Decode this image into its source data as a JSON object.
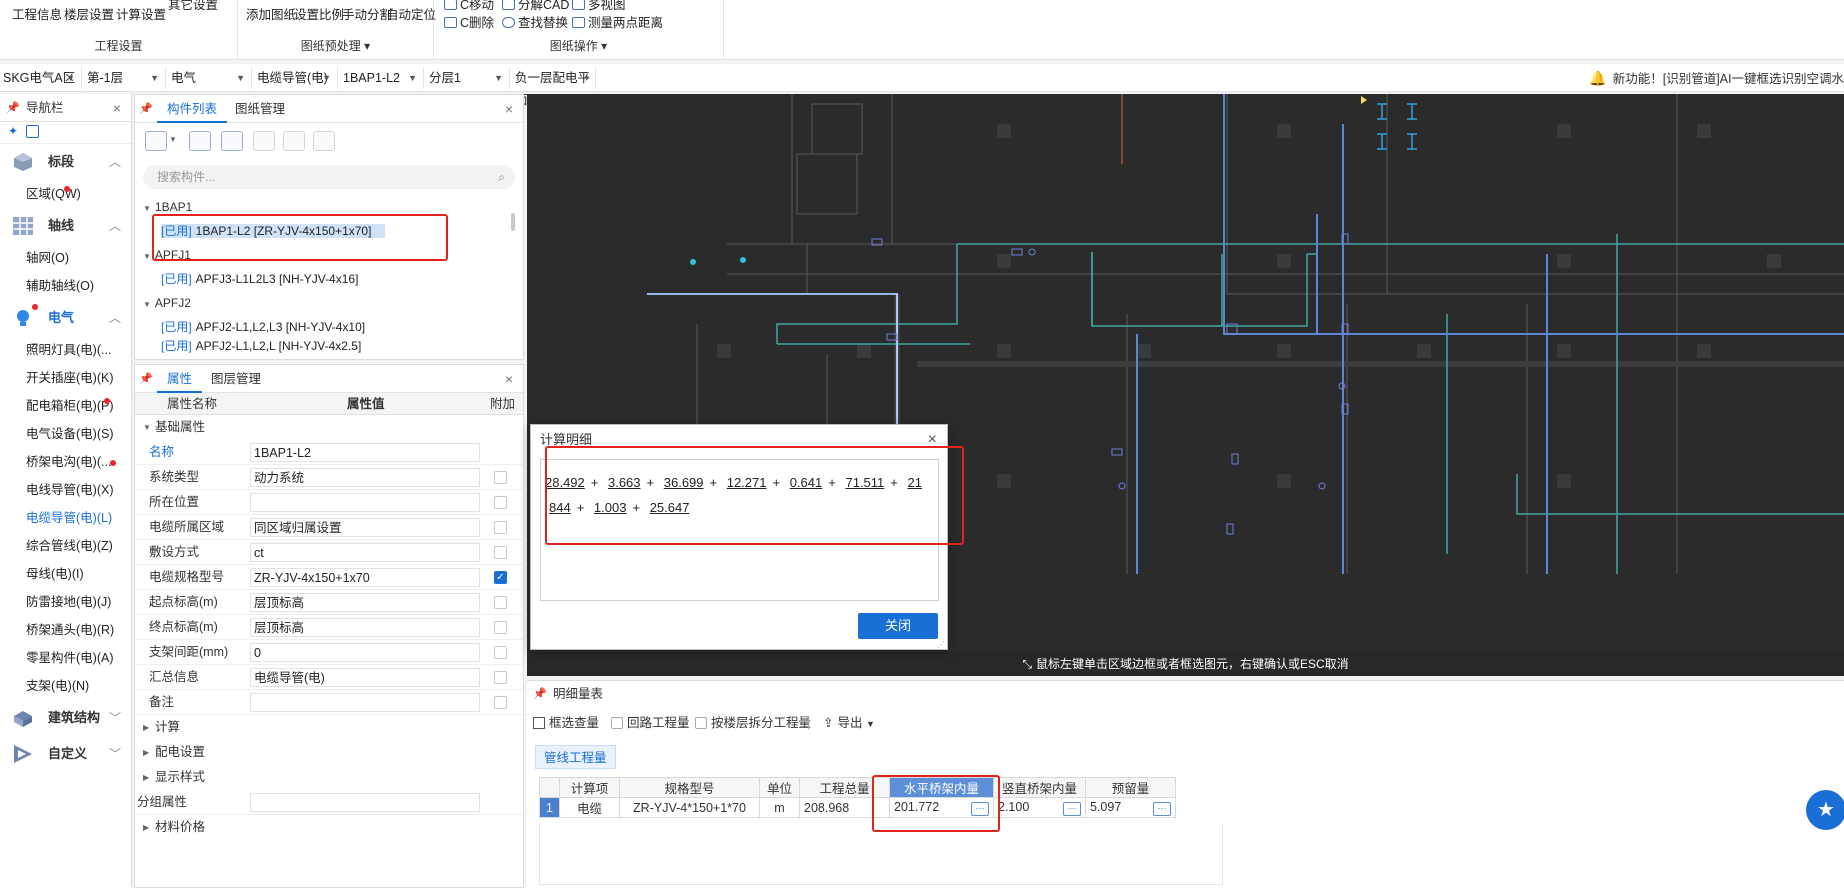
{
  "ribbon": {
    "group1": {
      "label": "工程设置",
      "items": [
        "工程信息",
        "楼层设置",
        "计算设置",
        "其它设置"
      ]
    },
    "group2": {
      "label": "图纸预处理",
      "items": [
        "添加图纸",
        "设置比例",
        "手动分割",
        "自动定位"
      ]
    },
    "group3": {
      "label": "图纸操作",
      "items": [
        "C移动",
        "分解CAD",
        "多视图",
        "C删除",
        "查找替换",
        "测量两点距离"
      ]
    }
  },
  "context": {
    "selects": [
      "SKG电气A区",
      "第-1层",
      "电气",
      "电缆导管(电)",
      "1BAP1-L2",
      "分层1",
      "负一层配电平面"
    ],
    "notice": "新功能！[识别管道]AI一键框选识别空调水"
  },
  "nav": {
    "title": "导航栏",
    "categories": {
      "biaoduan": "标段",
      "zhouxian": "轴线",
      "dianqi": "电气",
      "jianzhu": "建筑结构",
      "zidingyi": "自定义"
    },
    "biaoduan_items": [
      "区域(QW)"
    ],
    "zhouxian_items": [
      "轴网(O)",
      "辅助轴线(O)"
    ],
    "dianqi_items": [
      "照明灯具(电)(...",
      "开关插座(电)(K)",
      "配电箱柜(电)(P)",
      "电气设备(电)(S)",
      "桥架电沟(电)(...",
      "电线导管(电)(X)",
      "电缆导管(电)(L)",
      "综合管线(电)(Z)",
      "母线(电)(I)",
      "防雷接地(电)(J)",
      "桥架通头(电)(R)",
      "零星构件(电)(A)",
      "支架(电)(N)"
    ]
  },
  "complist": {
    "tabs": [
      "构件列表",
      "图纸管理"
    ],
    "search_placeholder": "搜索构件...",
    "used_tag": "[已用]",
    "groups": [
      {
        "name": "1BAP1",
        "items": [
          "1BAP1-L2 [ZR-YJV-4x150+1x70]"
        ]
      },
      {
        "name": "APFJ1",
        "items": [
          "APFJ3-L1L2L3 [NH-YJV-4x16]"
        ]
      },
      {
        "name": "APFJ2",
        "items": [
          "APFJ2-L1,L2,L3 [NH-YJV-4x10]",
          "APFJ2-L1,L2,L [NH-YJV-4x2.5]"
        ]
      }
    ]
  },
  "props": {
    "tabs": [
      "属性",
      "图层管理"
    ],
    "headers": [
      "属性名称",
      "属性值",
      "附加"
    ],
    "section_basic": "基础属性",
    "rows": [
      {
        "k": "名称",
        "v": "1BAP1-L2"
      },
      {
        "k": "系统类型",
        "v": "动力系统"
      },
      {
        "k": "所在位置",
        "v": ""
      },
      {
        "k": "电缆所属区域",
        "v": "同区域归属设置"
      },
      {
        "k": "敷设方式",
        "v": "ct"
      },
      {
        "k": "电缆规格型号",
        "v": "ZR-YJV-4x150+1x70"
      },
      {
        "k": "起点标高(m)",
        "v": "层顶标高"
      },
      {
        "k": "终点标高(m)",
        "v": "层顶标高"
      },
      {
        "k": "支架间距(mm)",
        "v": "0"
      },
      {
        "k": "汇总信息",
        "v": "电缆导管(电)"
      },
      {
        "k": "备注",
        "v": ""
      }
    ],
    "sections": [
      "计算",
      "配电设置",
      "显示样式"
    ],
    "group_attr": "分组属性",
    "material": "材料价格"
  },
  "canvas": {
    "hint": "鼠标左键单击区域边框或者框选图元，右键确认或ESC取消"
  },
  "dialog": {
    "title": "计算明细",
    "line1": [
      "28.492",
      "3.663",
      "36.699",
      "12.271",
      "0.641",
      "71.511",
      "21"
    ],
    "line2": [
      "844",
      "1.003",
      "25.647"
    ],
    "plus": "+",
    "close_label": "关闭"
  },
  "detail": {
    "title": "明细量表",
    "tools": [
      "框选查量",
      "回路工程量",
      "按楼层拆分工程量",
      "导出"
    ],
    "subtab": "管线工程量",
    "headers": [
      "计算项",
      "规格型号",
      "单位",
      "工程总量",
      "水平桥架内量",
      "竖直桥架内量",
      "预留量"
    ],
    "row": {
      "idx": "1",
      "item": "电缆",
      "spec": "ZR-YJV-4*150+1*70",
      "unit": "m",
      "total": "208.968",
      "horizontal": "201.772",
      "vertical": "2.100",
      "reserve": "5.097"
    }
  }
}
